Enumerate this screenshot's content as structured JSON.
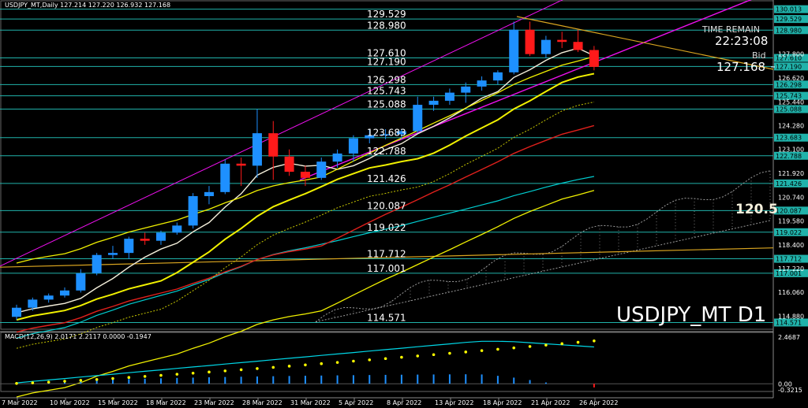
{
  "header": "USDJPY_MT,Daily  127.214 127.220 126.932 127.168",
  "time_remain_label": "TIME REMAIN",
  "time_remain_value": "22:23:08",
  "bid_label": "Bid",
  "bid_value": "127.168",
  "watermark": "USDJPY_MT D1",
  "ichimoku_value": "120.5",
  "macd_label": "MACD(12,26,9) 2.0171 2.2117 0.0000 -0.1947",
  "price_axis": {
    "min": 114.24,
    "max": 130.31,
    "ticks": [
      {
        "v": 130.013,
        "t": "130.013",
        "hl": true
      },
      {
        "v": 129.529,
        "t": "129.529",
        "hl": true
      },
      {
        "v": 128.98,
        "t": "128.980",
        "hl": true
      },
      {
        "v": 127.61,
        "t": "127.610",
        "hl": true
      },
      {
        "v": 127.19,
        "t": "127.190",
        "hl": true
      },
      {
        "v": 126.298,
        "t": "126.298",
        "hl": true
      },
      {
        "v": 125.743,
        "t": "125.743",
        "hl": true
      },
      {
        "v": 125.088,
        "t": "125.088",
        "hl": true
      },
      {
        "v": 123.683,
        "t": "123.683",
        "hl": true
      },
      {
        "v": 122.788,
        "t": "122.788",
        "hl": true
      },
      {
        "v": 121.426,
        "t": "121.426",
        "hl": true
      },
      {
        "v": 120.087,
        "t": "120.087",
        "hl": true
      },
      {
        "v": 119.022,
        "t": "119.022",
        "hl": true
      },
      {
        "v": 117.712,
        "t": "117.712",
        "hl": true
      },
      {
        "v": 117.001,
        "t": "117.001",
        "hl": true
      },
      {
        "v": 114.571,
        "t": "114.571",
        "hl": true
      },
      {
        "v": 127.8,
        "t": "127.800",
        "hl": false
      },
      {
        "v": 126.62,
        "t": "126.620",
        "hl": false
      },
      {
        "v": 125.44,
        "t": "125.440",
        "hl": false
      },
      {
        "v": 124.28,
        "t": "124.280",
        "hl": false
      },
      {
        "v": 123.1,
        "t": "123.100",
        "hl": false
      },
      {
        "v": 121.92,
        "t": "121.920",
        "hl": false
      },
      {
        "v": 120.74,
        "t": "120.740",
        "hl": false
      },
      {
        "v": 119.58,
        "t": "119.580",
        "hl": false
      },
      {
        "v": 118.4,
        "t": "118.400",
        "hl": false
      },
      {
        "v": 117.22,
        "t": "117.220",
        "hl": false
      },
      {
        "v": 116.06,
        "t": "116.060",
        "hl": false
      },
      {
        "v": 114.88,
        "t": "114.880",
        "hl": false
      }
    ]
  },
  "macd_axis": {
    "min": -0.3215,
    "max": 2.4687,
    "ticks": [
      {
        "v": 2.4687,
        "t": "2.4687"
      },
      {
        "v": 0.0,
        "t": "0.00"
      },
      {
        "v": -0.3215,
        "t": "-0.3215"
      }
    ]
  },
  "level_labels": [
    {
      "v": 129.529,
      "t": "129.529"
    },
    {
      "v": 128.98,
      "t": "128.980"
    },
    {
      "v": 127.61,
      "t": "127.610"
    },
    {
      "v": 127.19,
      "t": "127.190"
    },
    {
      "v": 126.298,
      "t": "126.298"
    },
    {
      "v": 125.743,
      "t": "125.743"
    },
    {
      "v": 125.088,
      "t": "125.088"
    },
    {
      "v": 123.683,
      "t": "123.683"
    },
    {
      "v": 122.788,
      "t": "122.788"
    },
    {
      "v": 121.426,
      "t": "121.426"
    },
    {
      "v": 120.087,
      "t": "120.087"
    },
    {
      "v": 119.022,
      "t": "119.022"
    },
    {
      "v": 117.712,
      "t": "117.712"
    },
    {
      "v": 117.001,
      "t": "117.001"
    },
    {
      "v": 114.571,
      "t": "114.571"
    }
  ],
  "date_labels": [
    "7 Mar 2022",
    "10 Mar 2022",
    "15 Mar 2022",
    "18 Mar 2022",
    "23 Mar 2022",
    "28 Mar 2022",
    "31 Mar 2022",
    "5 Apr 2022",
    "8 Apr 2022",
    "13 Apr 2022",
    "18 Apr 2022",
    "21 Apr 2022",
    "26 Apr 2022"
  ],
  "colors": {
    "bull": "#1e90ff",
    "bear": "#ff1a1a",
    "level": "#20b2aa",
    "level_label": "#00ffff",
    "yellow": "#f0f000",
    "white_ma": "#f5f0dc",
    "red_ma": "#e0201c",
    "cyan_ma": "#00ced1",
    "channel": "#ee10ee",
    "trend": "#daa520",
    "macd_line": "#00d6e6",
    "macd_sig": "#ffff00",
    "macd_hist": "#1e90ff"
  },
  "chart_data": {
    "type": "candlestick",
    "symbol": "USDJPY_MT",
    "timeframe": "Daily",
    "candles": [
      {
        "o": 114.85,
        "h": 115.45,
        "l": 114.7,
        "c": 115.3
      },
      {
        "o": 115.3,
        "h": 115.8,
        "l": 115.15,
        "c": 115.7
      },
      {
        "o": 115.7,
        "h": 116.0,
        "l": 115.55,
        "c": 115.9
      },
      {
        "o": 115.9,
        "h": 116.3,
        "l": 115.8,
        "c": 116.15
      },
      {
        "o": 116.15,
        "h": 117.2,
        "l": 116.05,
        "c": 117.0
      },
      {
        "o": 117.0,
        "h": 118.0,
        "l": 116.9,
        "c": 117.9
      },
      {
        "o": 117.9,
        "h": 118.35,
        "l": 117.7,
        "c": 118.0
      },
      {
        "o": 118.0,
        "h": 118.8,
        "l": 117.7,
        "c": 118.7
      },
      {
        "o": 118.7,
        "h": 119.0,
        "l": 118.4,
        "c": 118.6
      },
      {
        "o": 118.6,
        "h": 119.1,
        "l": 118.4,
        "c": 119.0
      },
      {
        "o": 119.0,
        "h": 119.5,
        "l": 118.9,
        "c": 119.35
      },
      {
        "o": 119.35,
        "h": 120.95,
        "l": 119.2,
        "c": 120.8
      },
      {
        "o": 120.8,
        "h": 121.3,
        "l": 120.4,
        "c": 121.0
      },
      {
        "o": 121.0,
        "h": 122.6,
        "l": 120.9,
        "c": 122.4
      },
      {
        "o": 122.4,
        "h": 122.7,
        "l": 121.3,
        "c": 122.3
      },
      {
        "o": 122.3,
        "h": 125.1,
        "l": 121.7,
        "c": 123.9
      },
      {
        "o": 123.9,
        "h": 124.5,
        "l": 121.6,
        "c": 122.75
      },
      {
        "o": 122.75,
        "h": 123.1,
        "l": 121.8,
        "c": 122.0
      },
      {
        "o": 122.0,
        "h": 122.3,
        "l": 121.3,
        "c": 121.7
      },
      {
        "o": 121.7,
        "h": 122.7,
        "l": 121.6,
        "c": 122.5
      },
      {
        "o": 122.5,
        "h": 123.1,
        "l": 122.2,
        "c": 122.9
      },
      {
        "o": 122.9,
        "h": 123.8,
        "l": 122.5,
        "c": 123.65
      },
      {
        "o": 123.65,
        "h": 124.1,
        "l": 123.4,
        "c": 123.8
      },
      {
        "o": 123.8,
        "h": 124.1,
        "l": 123.6,
        "c": 123.85
      },
      {
        "o": 123.85,
        "h": 124.1,
        "l": 123.6,
        "c": 124.0
      },
      {
        "o": 124.0,
        "h": 125.7,
        "l": 123.9,
        "c": 125.3
      },
      {
        "o": 125.3,
        "h": 125.7,
        "l": 125.0,
        "c": 125.5
      },
      {
        "o": 125.5,
        "h": 126.1,
        "l": 125.3,
        "c": 125.9
      },
      {
        "o": 125.9,
        "h": 126.4,
        "l": 125.4,
        "c": 126.2
      },
      {
        "o": 126.2,
        "h": 126.7,
        "l": 126.0,
        "c": 126.5
      },
      {
        "o": 126.5,
        "h": 127.0,
        "l": 126.3,
        "c": 126.9
      },
      {
        "o": 126.9,
        "h": 129.4,
        "l": 126.8,
        "c": 129.0
      },
      {
        "o": 129.0,
        "h": 129.4,
        "l": 127.7,
        "c": 127.8
      },
      {
        "o": 127.8,
        "h": 128.7,
        "l": 127.6,
        "c": 128.5
      },
      {
        "o": 128.5,
        "h": 128.9,
        "l": 128.1,
        "c": 128.4
      },
      {
        "o": 128.4,
        "h": 129.0,
        "l": 127.9,
        "c": 128.0
      },
      {
        "o": 128.0,
        "h": 128.2,
        "l": 127.0,
        "c": 127.17
      }
    ]
  }
}
